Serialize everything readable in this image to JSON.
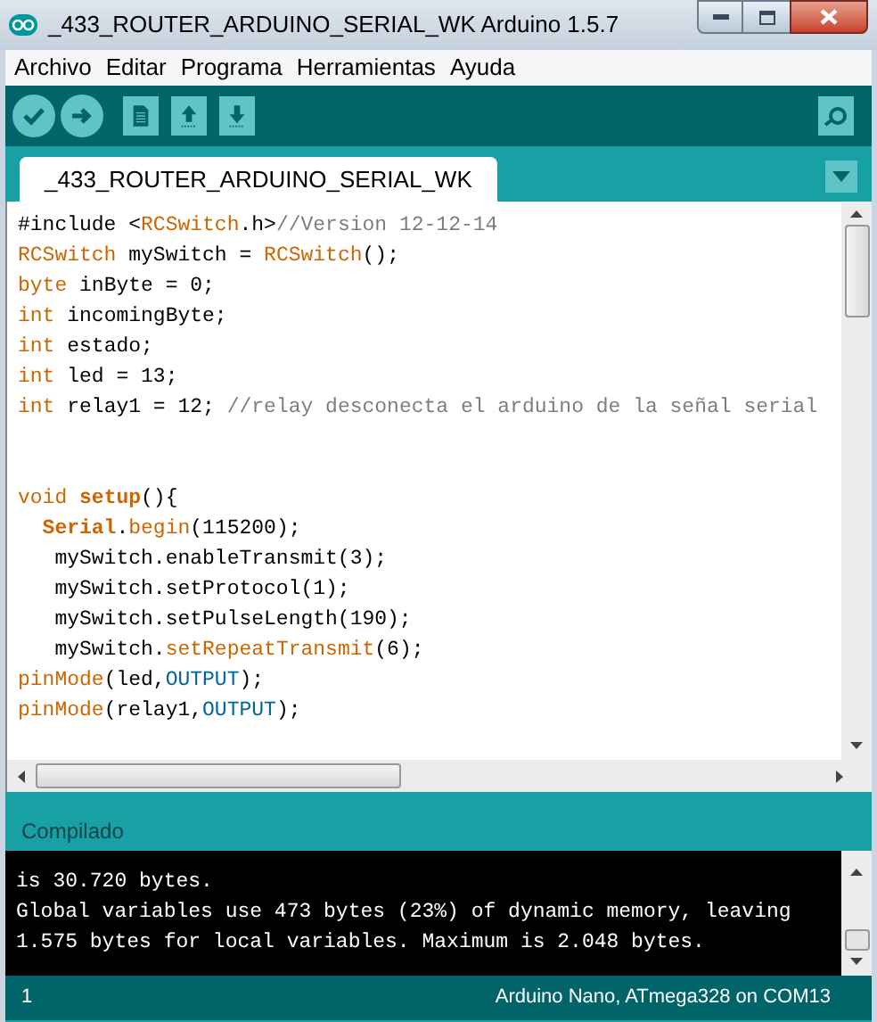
{
  "window": {
    "title": "_433_ROUTER_ARDUINO_SERIAL_WK Arduino 1.5.7"
  },
  "menu": [
    "Archivo",
    "Editar",
    "Programa",
    "Herramientas",
    "Ayuda"
  ],
  "toolbar": [
    {
      "kind": "verify"
    },
    {
      "kind": "upload"
    },
    {
      "kind": "new"
    },
    {
      "kind": "open"
    },
    {
      "kind": "save"
    }
  ],
  "tabs": [
    {
      "label": "_433_ROUTER_ARDUINO_SERIAL_WK",
      "selected": true
    }
  ],
  "code": [
    {
      "kind": "code",
      "segments": [
        {
          "kind": "plain",
          "text": "#include <"
        },
        {
          "kind": "type",
          "text": "RCSwitch"
        },
        {
          "kind": "plain",
          "text": ".h>"
        },
        {
          "kind": "comment",
          "text": "//Version 12-12-14"
        }
      ]
    },
    {
      "kind": "code",
      "segments": [
        {
          "kind": "type",
          "text": "RCSwitch"
        },
        {
          "kind": "plain",
          "text": " mySwitch = "
        },
        {
          "kind": "type",
          "text": "RCSwitch"
        },
        {
          "kind": "plain",
          "text": "();"
        }
      ]
    },
    {
      "kind": "code",
      "segments": [
        {
          "kind": "type",
          "text": "byte"
        },
        {
          "kind": "plain",
          "text": " inByte = 0;"
        }
      ]
    },
    {
      "kind": "code",
      "segments": [
        {
          "kind": "type",
          "text": "int"
        },
        {
          "kind": "plain",
          "text": " incomingByte;"
        }
      ]
    },
    {
      "kind": "code",
      "segments": [
        {
          "kind": "type",
          "text": "int"
        },
        {
          "kind": "plain",
          "text": " estado;"
        }
      ]
    },
    {
      "kind": "code",
      "segments": [
        {
          "kind": "type",
          "text": "int"
        },
        {
          "kind": "plain",
          "text": " led = 13;"
        }
      ]
    },
    {
      "kind": "code",
      "segments": [
        {
          "kind": "type",
          "text": "int"
        },
        {
          "kind": "plain",
          "text": " relay1 = 12; "
        },
        {
          "kind": "comment",
          "text": "//relay desconecta el arduino de la señal serial"
        }
      ]
    },
    {
      "kind": "blank"
    },
    {
      "kind": "blank"
    },
    {
      "kind": "code",
      "segments": [
        {
          "kind": "type",
          "text": "void "
        },
        {
          "kind": "bold",
          "text": "setup"
        },
        {
          "kind": "plain",
          "text": "(){"
        }
      ]
    },
    {
      "kind": "code",
      "segments": [
        {
          "kind": "bold",
          "text": "  Serial"
        },
        {
          "kind": "plain",
          "text": "."
        },
        {
          "kind": "type",
          "text": "begin"
        },
        {
          "kind": "plain",
          "text": "(115200);"
        }
      ]
    },
    {
      "kind": "code",
      "segments": [
        {
          "kind": "plain",
          "text": "   mySwitch.enableTransmit(3);"
        }
      ]
    },
    {
      "kind": "code",
      "segments": [
        {
          "kind": "plain",
          "text": "   mySwitch.setProtocol(1);"
        }
      ]
    },
    {
      "kind": "code",
      "segments": [
        {
          "kind": "plain",
          "text": "   mySwitch.setPulseLength(190);"
        }
      ]
    },
    {
      "kind": "code",
      "segments": [
        {
          "kind": "plain",
          "text": "   mySwitch."
        },
        {
          "kind": "type",
          "text": "setRepeatTransmit"
        },
        {
          "kind": "plain",
          "text": "(6);"
        }
      ]
    },
    {
      "kind": "code",
      "segments": [
        {
          "kind": "type",
          "text": "pinMode"
        },
        {
          "kind": "plain",
          "text": "(led,"
        },
        {
          "kind": "constant",
          "text": "OUTPUT"
        },
        {
          "kind": "plain",
          "text": ");"
        }
      ]
    },
    {
      "kind": "code",
      "segments": [
        {
          "kind": "type",
          "text": "pinMode"
        },
        {
          "kind": "plain",
          "text": "(relay1,"
        },
        {
          "kind": "constant",
          "text": "OUTPUT"
        },
        {
          "kind": "plain",
          "text": ");"
        }
      ]
    }
  ],
  "status_message": "Compilado",
  "console": [
    "is 30.720 bytes.",
    "Global variables use 473 bytes (23%) of dynamic memory, leaving",
    "1.575 bytes for local variables. Maximum is 2.048 bytes."
  ],
  "status_bar": {
    "line": "1",
    "board": "Arduino Nano, ATmega328 on COM13"
  }
}
